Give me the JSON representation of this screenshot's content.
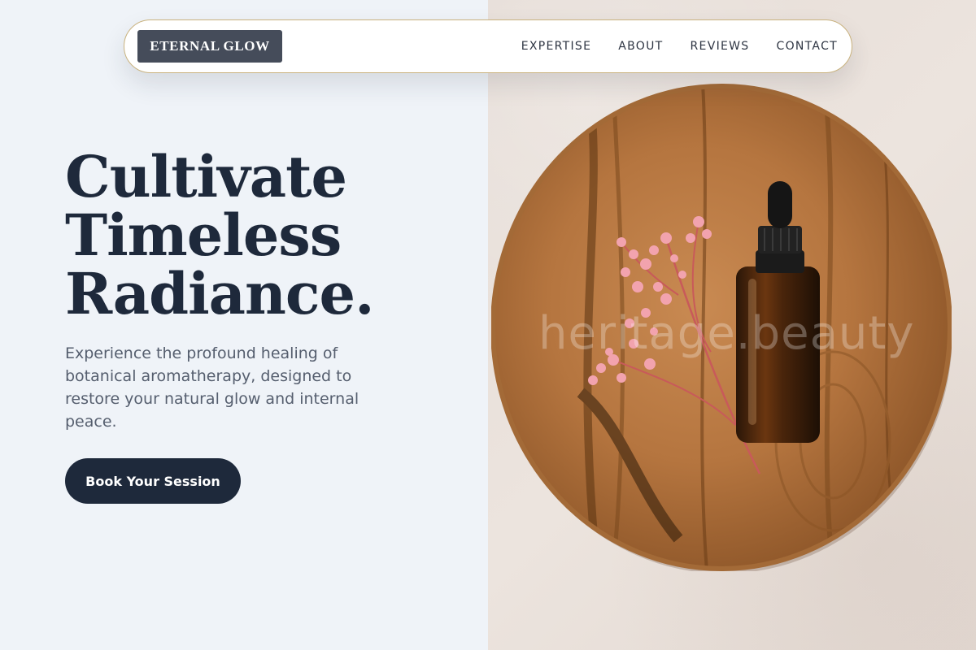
{
  "brand": {
    "name": "ETERNAL GLOW"
  },
  "nav": {
    "links": [
      {
        "label": "EXPERTISE"
      },
      {
        "label": "ABOUT"
      },
      {
        "label": "REVIEWS"
      },
      {
        "label": "CONTACT"
      }
    ]
  },
  "hero": {
    "title_lines": [
      "Cultivate",
      "Timeless",
      "Radiance."
    ],
    "description": "Experience the profound healing of botanical aromatherapy, designed to restore your natural glow and internal peace.",
    "cta_label": "Book Your Session"
  },
  "image": {
    "watermark": "heritage.beauty"
  },
  "colors": {
    "primary": "#1e293b",
    "logo_bg": "#454c5a",
    "page_bg": "#eff3f8",
    "nav_border": "#c9b27e"
  }
}
